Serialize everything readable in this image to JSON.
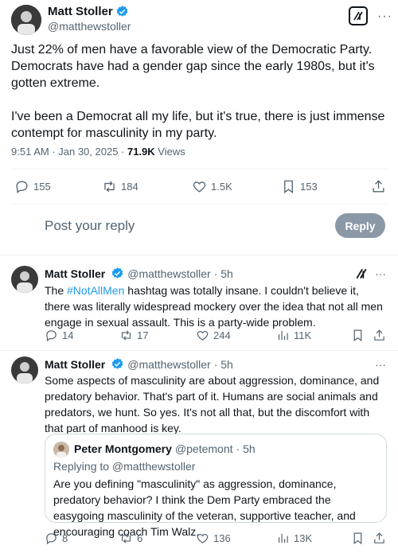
{
  "main_tweet": {
    "name": "Matt Stoller",
    "handle": "@matthewstoller",
    "paragraph1": "Just 22% of men have a favorable view of the Democratic Party. Democrats have had a gender gap since the early 1980s, but it's gotten extreme.",
    "paragraph2": "I've been a Democrat all my life, but it's true, there is just immense contempt for masculinity in my party.",
    "timestamp": "9:51 AM · Jan 30, 2025 · ",
    "views_count": "71.9K",
    "views_label": " Views",
    "replies": "155",
    "retweets": "184",
    "likes": "1.5K",
    "bookmarks": "153"
  },
  "reply_box": {
    "placeholder": "Post your reply",
    "button_label": "Reply"
  },
  "reply1": {
    "name": "Matt Stoller",
    "handle": "@matthewstoller",
    "time": "· 5h",
    "hashtag": "#NotAllMen",
    "text_before": "The ",
    "text_after": " hashtag was totally insane. I couldn't believe it, there was literally widespread mockery over the idea that not all men engage in sexual assault. This is a party-wide problem.",
    "replies": "14",
    "retweets": "17",
    "likes": "244",
    "views": "11K"
  },
  "reply2": {
    "name": "Matt Stoller",
    "handle": "@matthewstoller",
    "time": "· 5h",
    "text": "Some aspects of masculinity are about aggression, dominance, and predatory behavior. That's part of it. Humans are social animals and predators, we hunt. So yes. It's not all that, but the discomfort with that part of manhood is key.",
    "replies": "8",
    "retweets": "6",
    "likes": "136",
    "views": "13K"
  },
  "quote": {
    "name": "Peter Montgomery",
    "handle": "@petemont",
    "time": "· 5h",
    "replying_to": "Replying to @matthewstoller",
    "text": "Are you defining \"masculinity\" as aggression, dominance, predatory behavior? I think the Dem Party embraced the easygoing masculinity of the veteran, supportive teacher, and encouraging coach Tim Walz."
  },
  "colors": {
    "verified": "#1d9bf0",
    "reply_button": "#8b98a5",
    "text_muted": "#536471"
  },
  "icons": [
    "verified-badge-icon",
    "grok-icon",
    "more-icon",
    "reply-icon",
    "retweet-icon",
    "like-icon",
    "views-icon",
    "bookmark-icon",
    "share-icon"
  ]
}
